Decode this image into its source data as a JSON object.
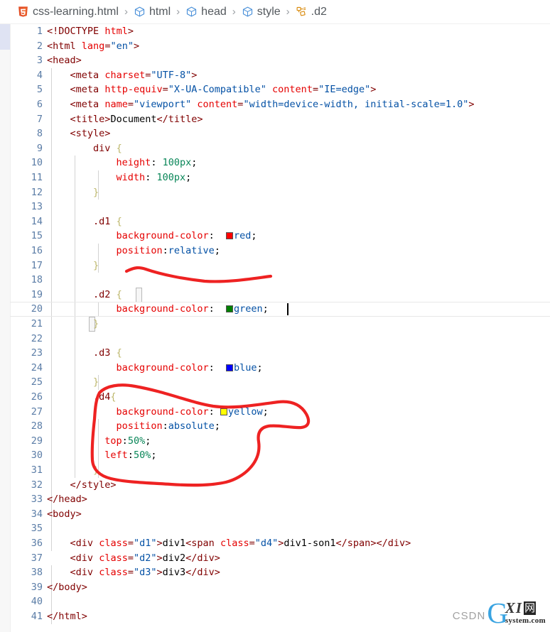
{
  "breadcrumb": {
    "items": [
      {
        "icon": "html5-file-icon",
        "label": "css-learning.html"
      },
      {
        "icon": "symbol-namespace-icon",
        "label": "html"
      },
      {
        "icon": "symbol-namespace-icon",
        "label": "head"
      },
      {
        "icon": "symbol-namespace-icon",
        "label": "style"
      },
      {
        "icon": "symbol-ruler-icon",
        "label": ".d2"
      }
    ],
    "separator": "›"
  },
  "editor": {
    "active_line": 20,
    "cursor": {
      "line": 20,
      "after_text": "green;"
    },
    "line_numbers": [
      1,
      2,
      3,
      4,
      5,
      6,
      7,
      8,
      9,
      10,
      11,
      12,
      13,
      14,
      15,
      16,
      17,
      18,
      19,
      20,
      21,
      22,
      23,
      24,
      25,
      26,
      27,
      28,
      29,
      30,
      31,
      32,
      33,
      34,
      35,
      36,
      37,
      38,
      39,
      40,
      41
    ],
    "lines": [
      {
        "n": 1,
        "text": "<!DOCTYPE html>"
      },
      {
        "n": 2,
        "text": "<html lang=\"en\">"
      },
      {
        "n": 3,
        "text": "<head>"
      },
      {
        "n": 4,
        "text": "    <meta charset=\"UTF-8\">"
      },
      {
        "n": 5,
        "text": "    <meta http-equiv=\"X-UA-Compatible\" content=\"IE=edge\">"
      },
      {
        "n": 6,
        "text": "    <meta name=\"viewport\" content=\"width=device-width, initial-scale=1.0\">"
      },
      {
        "n": 7,
        "text": "    <title>Document</title>"
      },
      {
        "n": 8,
        "text": "    <style>"
      },
      {
        "n": 9,
        "text": "        div {"
      },
      {
        "n": 10,
        "text": "            height: 100px;"
      },
      {
        "n": 11,
        "text": "            width: 100px;"
      },
      {
        "n": 12,
        "text": "        }"
      },
      {
        "n": 13,
        "text": ""
      },
      {
        "n": 14,
        "text": "        .d1 {"
      },
      {
        "n": 15,
        "text": "            background-color:  red;"
      },
      {
        "n": 16,
        "text": "            position:relative;"
      },
      {
        "n": 17,
        "text": "        }"
      },
      {
        "n": 18,
        "text": ""
      },
      {
        "n": 19,
        "text": "        .d2 {"
      },
      {
        "n": 20,
        "text": "            background-color:  green;"
      },
      {
        "n": 21,
        "text": "        }"
      },
      {
        "n": 22,
        "text": ""
      },
      {
        "n": 23,
        "text": "        .d3 {"
      },
      {
        "n": 24,
        "text": "            background-color:  blue;"
      },
      {
        "n": 25,
        "text": "        }"
      },
      {
        "n": 26,
        "text": "        .d4{"
      },
      {
        "n": 27,
        "text": "            background-color: yellow;"
      },
      {
        "n": 28,
        "text": "            position:absolute;"
      },
      {
        "n": 29,
        "text": "          top:50%;"
      },
      {
        "n": 30,
        "text": "          left:50%;"
      },
      {
        "n": 31,
        "text": "        }"
      },
      {
        "n": 32,
        "text": "    </style>"
      },
      {
        "n": 33,
        "text": "</head>"
      },
      {
        "n": 34,
        "text": "<body>"
      },
      {
        "n": 35,
        "text": ""
      },
      {
        "n": 36,
        "text": "    <div class=\"d1\">div1<span class=\"d4\">div1-son1</span></div>"
      },
      {
        "n": 37,
        "text": "    <div class=\"d2\">div2</div>"
      },
      {
        "n": 38,
        "text": "    <div class=\"d3\">div3</div>"
      },
      {
        "n": 39,
        "text": "</body>"
      },
      {
        "n": 40,
        "text": ""
      },
      {
        "n": 41,
        "text": "</html>"
      }
    ],
    "color_swatches": [
      {
        "line": 15,
        "value": "red",
        "hex": "#ff0000"
      },
      {
        "line": 20,
        "value": "green",
        "hex": "#008000"
      },
      {
        "line": 24,
        "value": "blue",
        "hex": "#0000ff"
      },
      {
        "line": 27,
        "value": "yellow",
        "hex": "#ffff00"
      }
    ]
  },
  "annotations": {
    "stroke_color": "#ee2222",
    "items": [
      {
        "name": "underline-d1-block",
        "shape": "squiggly-underline",
        "target_line": 17
      },
      {
        "name": "circle-d4-block",
        "shape": "hand-drawn-loop",
        "target_lines": "26-31"
      }
    ]
  },
  "watermark": {
    "csdn": "CSDN",
    "logo_letter": "G",
    "logo_xi": "XI",
    "logo_cn": "网",
    "logo_domain": "system.com"
  },
  "theme": {
    "background": "#ffffff",
    "gutter_number": "#5a7ca6",
    "tag_color": "#800000",
    "attribute_color": "#e50000",
    "string_color": "#0451a5",
    "number_color": "#098658",
    "brace_color": "#bdb76b",
    "active_line_border": "#e8e8e8",
    "indent_guide": "#d3d3d3",
    "scroll_thumb": "#dfe3f3"
  }
}
